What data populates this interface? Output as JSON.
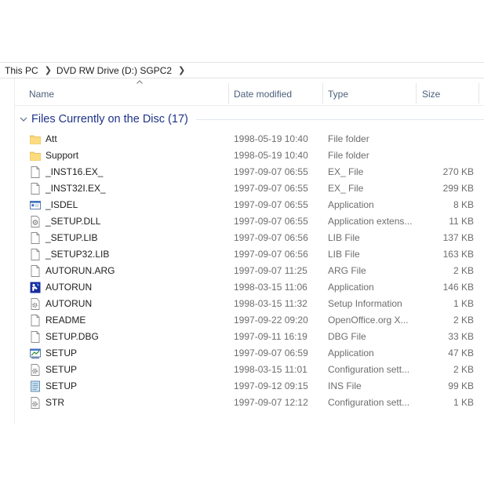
{
  "breadcrumb": {
    "items": [
      "This PC",
      "DVD RW Drive (D:) SGPC2"
    ]
  },
  "columns": {
    "name": "Name",
    "date": "Date modified",
    "type": "Type",
    "size": "Size"
  },
  "group": {
    "label": "Files Currently on the Disc (17)"
  },
  "files": [
    {
      "name": "Att",
      "date": "1998-05-19 10:40",
      "type": "File folder",
      "size": "",
      "icon": "folder-icon"
    },
    {
      "name": "Support",
      "date": "1998-05-19 10:40",
      "type": "File folder",
      "size": "",
      "icon": "folder-icon"
    },
    {
      "name": "_INST16.EX_",
      "date": "1997-09-07 06:55",
      "type": "EX_ File",
      "size": "270 KB",
      "icon": "file-icon"
    },
    {
      "name": "_INST32I.EX_",
      "date": "1997-09-07 06:55",
      "type": "EX_ File",
      "size": "299 KB",
      "icon": "file-icon"
    },
    {
      "name": "_ISDEL",
      "date": "1997-09-07 06:55",
      "type": "Application",
      "size": "8 KB",
      "icon": "application-icon"
    },
    {
      "name": "_SETUP.DLL",
      "date": "1997-09-07 06:55",
      "type": "Application extens...",
      "size": "11 KB",
      "icon": "dll-icon"
    },
    {
      "name": "_SETUP.LIB",
      "date": "1997-09-07 06:56",
      "type": "LIB File",
      "size": "137 KB",
      "icon": "file-icon"
    },
    {
      "name": "_SETUP32.LIB",
      "date": "1997-09-07 06:56",
      "type": "LIB File",
      "size": "163 KB",
      "icon": "file-icon"
    },
    {
      "name": "AUTORUN.ARG",
      "date": "1997-09-07 11:25",
      "type": "ARG File",
      "size": "2 KB",
      "icon": "file-icon"
    },
    {
      "name": "AUTORUN",
      "date": "1998-03-15 11:06",
      "type": "Application",
      "size": "146 KB",
      "icon": "autorun-app-icon"
    },
    {
      "name": "AUTORUN",
      "date": "1998-03-15 11:32",
      "type": "Setup Information",
      "size": "1 KB",
      "icon": "setup-info-icon"
    },
    {
      "name": "README",
      "date": "1997-09-22 09:20",
      "type": "OpenOffice.org X...",
      "size": "2 KB",
      "icon": "file-icon"
    },
    {
      "name": "SETUP.DBG",
      "date": "1997-09-11 16:19",
      "type": "DBG File",
      "size": "33 KB",
      "icon": "file-icon"
    },
    {
      "name": "SETUP",
      "date": "1997-09-07 06:59",
      "type": "Application",
      "size": "47 KB",
      "icon": "setup-app-icon"
    },
    {
      "name": "SETUP",
      "date": "1998-03-15 11:01",
      "type": "Configuration sett...",
      "size": "2 KB",
      "icon": "config-icon"
    },
    {
      "name": "SETUP",
      "date": "1997-09-12 09:15",
      "type": "INS File",
      "size": "99 KB",
      "icon": "ins-icon"
    },
    {
      "name": "STR",
      "date": "1997-09-07 12:12",
      "type": "Configuration sett...",
      "size": "1 KB",
      "icon": "config-icon"
    }
  ]
}
